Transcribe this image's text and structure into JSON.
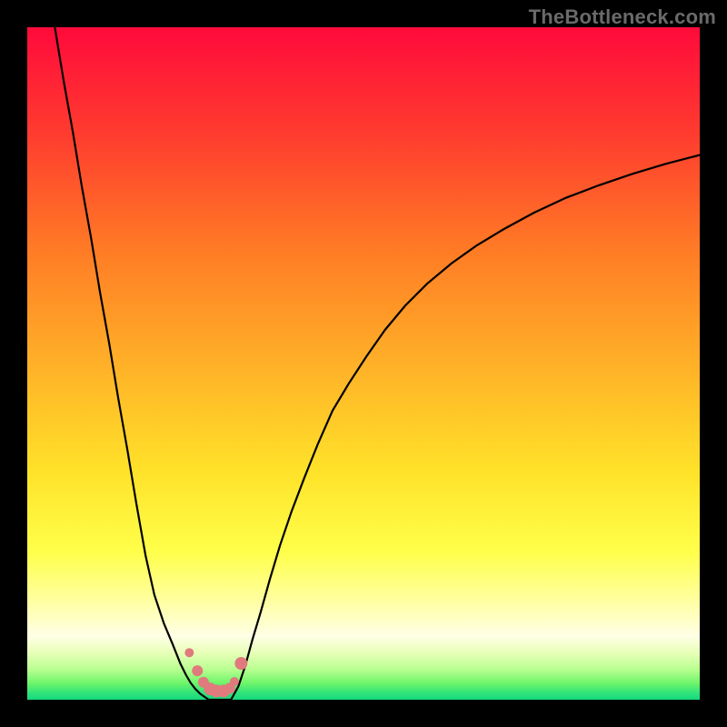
{
  "watermark": "TheBottleneck.com",
  "chart_data": {
    "type": "line",
    "title": "",
    "xlabel": "",
    "ylabel": "",
    "xlim": [
      0,
      100
    ],
    "ylim": [
      0,
      100
    ],
    "grid": false,
    "legend": false,
    "series": [
      {
        "name": "left-curve",
        "x": [
          4.1,
          5.4,
          6.8,
          8.1,
          9.5,
          10.8,
          12.2,
          13.5,
          14.9,
          16.2,
          17.6,
          18.9,
          20.3,
          21.6,
          22.8,
          23.6,
          24.3,
          25.0,
          25.7,
          26.4,
          27.0
        ],
        "y": [
          100.0,
          92.1,
          84.3,
          76.4,
          68.6,
          60.7,
          52.9,
          45.0,
          37.1,
          29.3,
          21.4,
          15.6,
          11.4,
          8.3,
          5.3,
          3.7,
          2.5,
          1.6,
          0.9,
          0.4,
          0.0
        ]
      },
      {
        "name": "right-curve",
        "x": [
          30.3,
          31.4,
          32.4,
          33.5,
          34.7,
          36.1,
          37.6,
          39.3,
          41.2,
          43.2,
          45.4,
          47.8,
          50.4,
          53.2,
          56.2,
          59.5,
          63.1,
          66.9,
          70.9,
          75.3,
          80.0,
          85.0,
          90.0,
          95.0,
          100.0
        ],
        "y": [
          0.0,
          2.0,
          5.0,
          9.0,
          13.0,
          18.0,
          23.0,
          28.0,
          33.0,
          38.0,
          43.0,
          47.0,
          51.0,
          55.0,
          58.6,
          61.9,
          64.9,
          67.6,
          70.0,
          72.4,
          74.6,
          76.5,
          78.2,
          79.7,
          81.0
        ]
      },
      {
        "name": "curve-floor",
        "x": [
          27.0,
          28.0,
          29.0,
          30.3
        ],
        "y": [
          0.0,
          0.0,
          0.0,
          0.0
        ]
      }
    ],
    "markers": {
      "name": "bottleneck-points",
      "color": "#e07a7d",
      "points": [
        {
          "x": 24.1,
          "y": 7.0,
          "r": 5
        },
        {
          "x": 25.3,
          "y": 4.3,
          "r": 6
        },
        {
          "x": 26.2,
          "y": 2.6,
          "r": 6
        },
        {
          "x": 27.2,
          "y": 1.6,
          "r": 7
        },
        {
          "x": 28.1,
          "y": 1.3,
          "r": 7
        },
        {
          "x": 29.2,
          "y": 1.3,
          "r": 7
        },
        {
          "x": 30.1,
          "y": 1.7,
          "r": 6
        },
        {
          "x": 30.8,
          "y": 2.7,
          "r": 5
        },
        {
          "x": 31.8,
          "y": 5.4,
          "r": 7
        }
      ]
    },
    "gradient_stops": [
      {
        "offset": 0.0,
        "color": "#ff0a3b"
      },
      {
        "offset": 0.16,
        "color": "#ff3c2f"
      },
      {
        "offset": 0.34,
        "color": "#ff7e25"
      },
      {
        "offset": 0.5,
        "color": "#ffb028"
      },
      {
        "offset": 0.66,
        "color": "#ffe229"
      },
      {
        "offset": 0.78,
        "color": "#ffff4a"
      },
      {
        "offset": 0.85,
        "color": "#ffff9e"
      },
      {
        "offset": 0.905,
        "color": "#ffffe6"
      },
      {
        "offset": 0.93,
        "color": "#e8ffb8"
      },
      {
        "offset": 0.955,
        "color": "#b8ff90"
      },
      {
        "offset": 0.975,
        "color": "#70f56a"
      },
      {
        "offset": 0.99,
        "color": "#2fe37a"
      },
      {
        "offset": 1.0,
        "color": "#16d87d"
      }
    ]
  }
}
